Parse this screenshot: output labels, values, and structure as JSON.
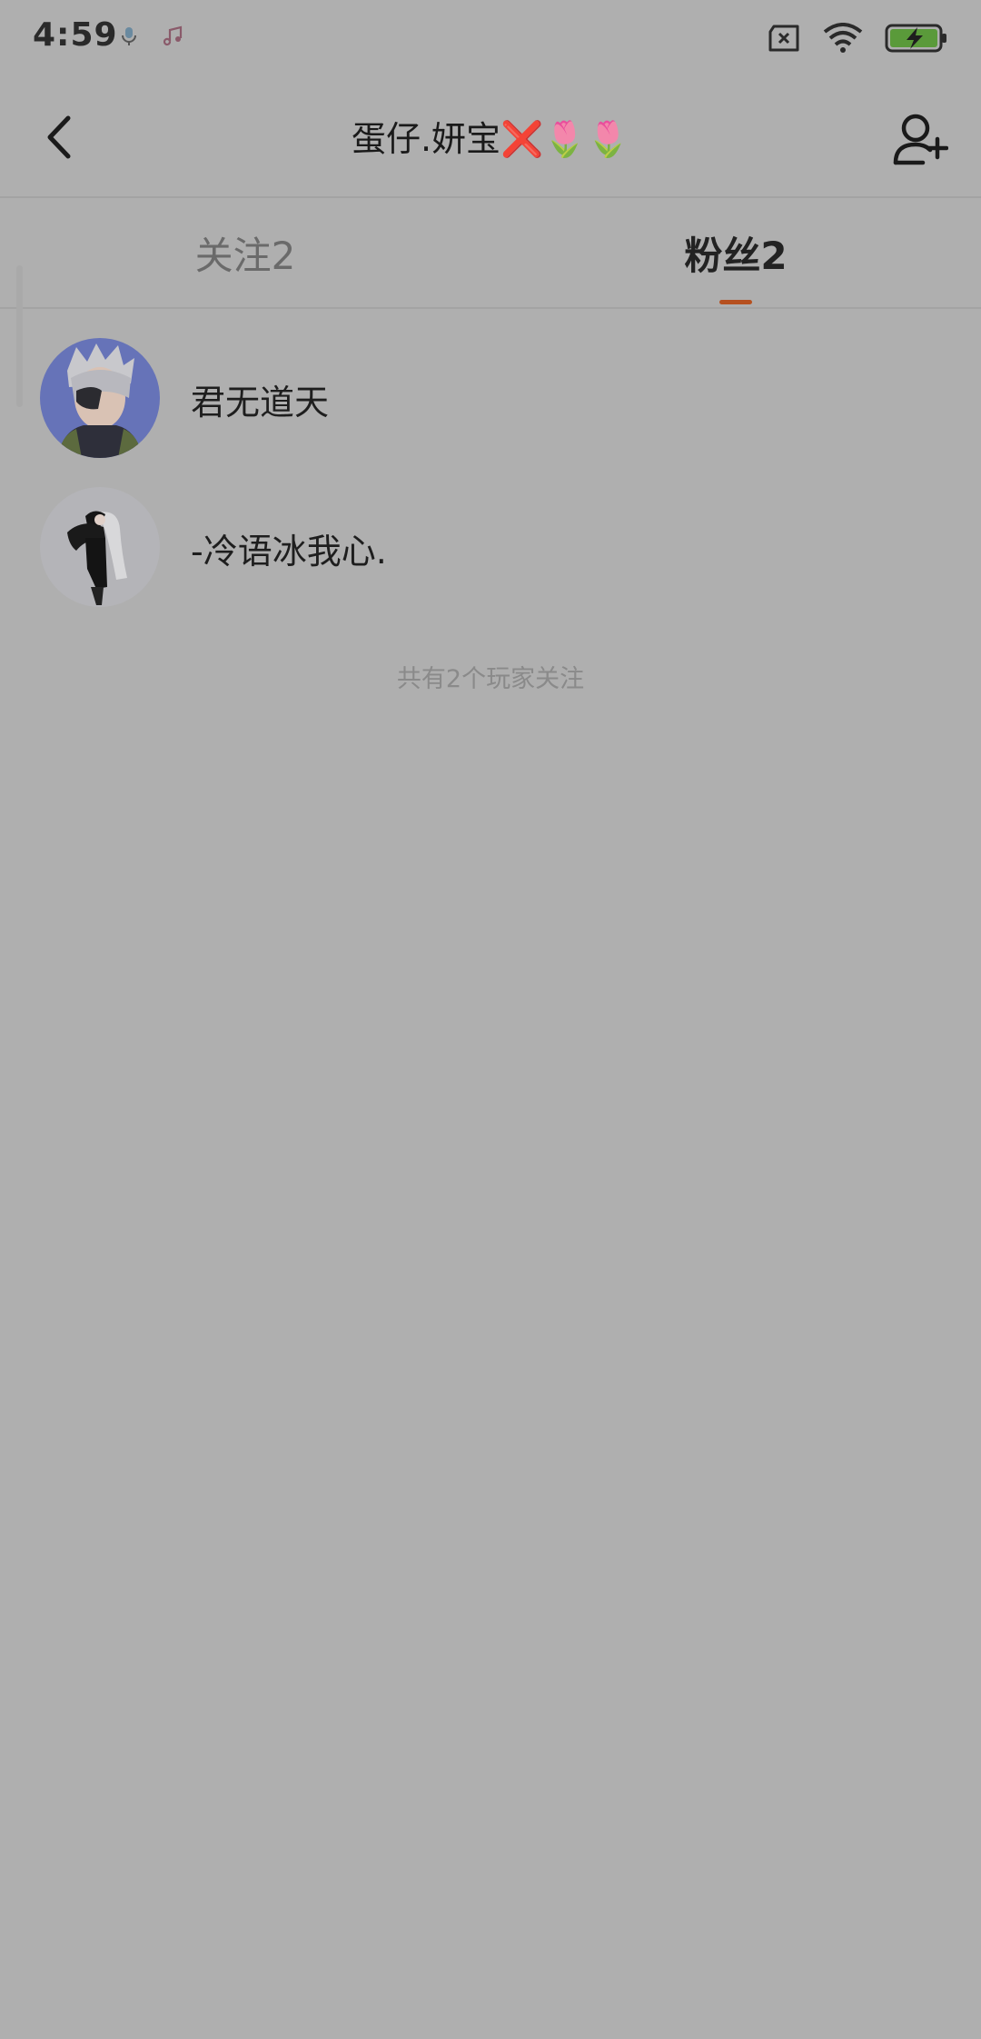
{
  "status_bar": {
    "time": "4:59",
    "icons": [
      "mic-icon",
      "music-icon",
      "no-sim-icon",
      "wifi-icon",
      "battery-charging-icon"
    ]
  },
  "header": {
    "title": "蛋仔.妍宝",
    "title_emojis": [
      "❌",
      "🌷",
      "🌷"
    ],
    "back_icon": "chevron-left-icon",
    "add_friend_icon": "add-user-icon"
  },
  "tabs": [
    {
      "label": "关注2",
      "active": false
    },
    {
      "label": "粉丝2",
      "active": true
    }
  ],
  "accent_color": "#b6501f",
  "fans": [
    {
      "name": "君无道天"
    },
    {
      "name": "-冷语冰我心."
    }
  ],
  "footer_note": "共有2个玩家关注"
}
